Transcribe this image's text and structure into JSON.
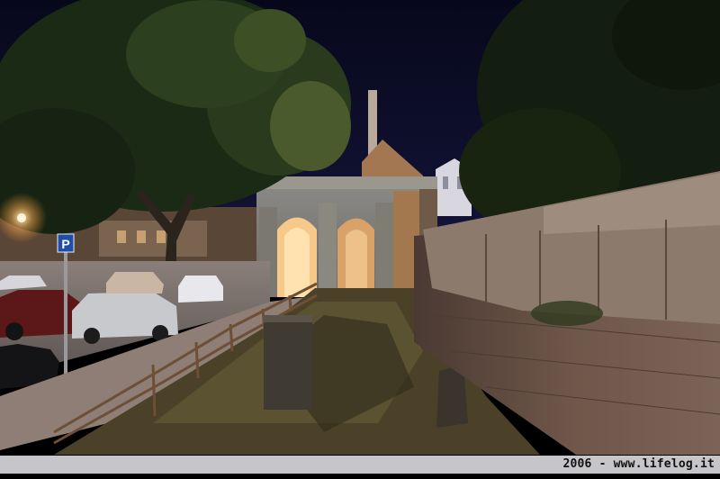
{
  "photo": {
    "subject": "",
    "caption": "2006 - www.lifelog.it"
  },
  "signs": {
    "parking_letter": "P"
  },
  "colors": {
    "sky": "#0b0b26",
    "foliage": "#1d2a16",
    "stone_wall": "#6b5548",
    "arch_stone": "#8e8c86",
    "street_light": "#ffd9a0",
    "caption_bg": "#e2e2e6"
  }
}
